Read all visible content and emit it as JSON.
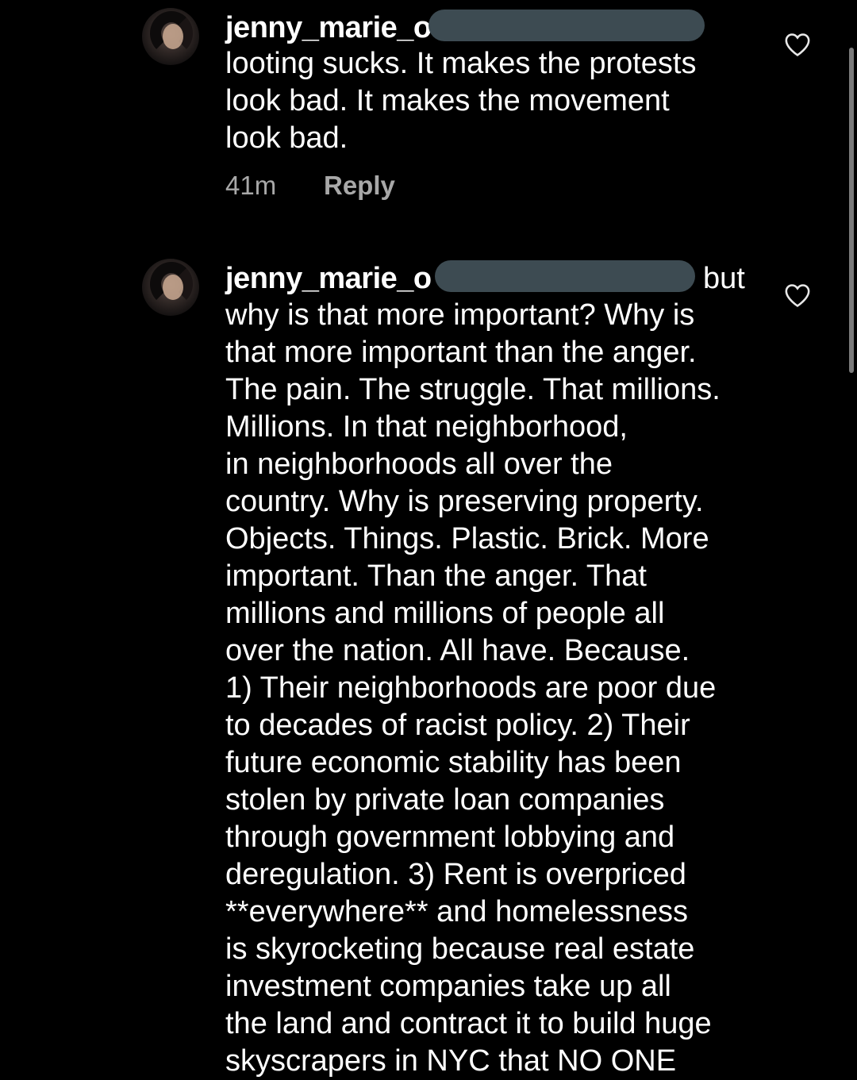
{
  "comments": [
    {
      "username": "jenny_marie_o",
      "text": "looting sucks. It makes the protests\nlook bad. It makes the movement\nlook bad.",
      "time": "41m",
      "reply_label": "Reply"
    },
    {
      "username": "jenny_marie_o",
      "head_suffix": "but",
      "text": "why is that more important? Why is\nthat more important than the anger.\nThe pain. The struggle. That millions.\nMillions. In that neighborhood,\nin neighborhoods all over the\ncountry. Why is preserving property.\nObjects. Things. Plastic. Brick. More\nimportant. Than the anger. That\nmillions and millions of people all\nover the nation. All have. Because.\n1) Their neighborhoods are poor due\nto decades of racist policy. 2) Their\nfuture economic stability has been\nstolen by private loan companies\nthrough government lobbying and\nderegulation. 3) Rent is overpriced\n**everywhere** and homelessness\nis skyrocketing because real estate\ninvestment companies take up all\nthe land and contract it to build huge\nskyscrapers in NYC that NO ONE"
    }
  ],
  "icons": {
    "avatar": "profile-photo",
    "like": "heart-outline-icon"
  },
  "colors": {
    "background": "#000000",
    "text": "#ffffff",
    "meta": "#a8a8a8",
    "redaction": "#3d4b52"
  }
}
